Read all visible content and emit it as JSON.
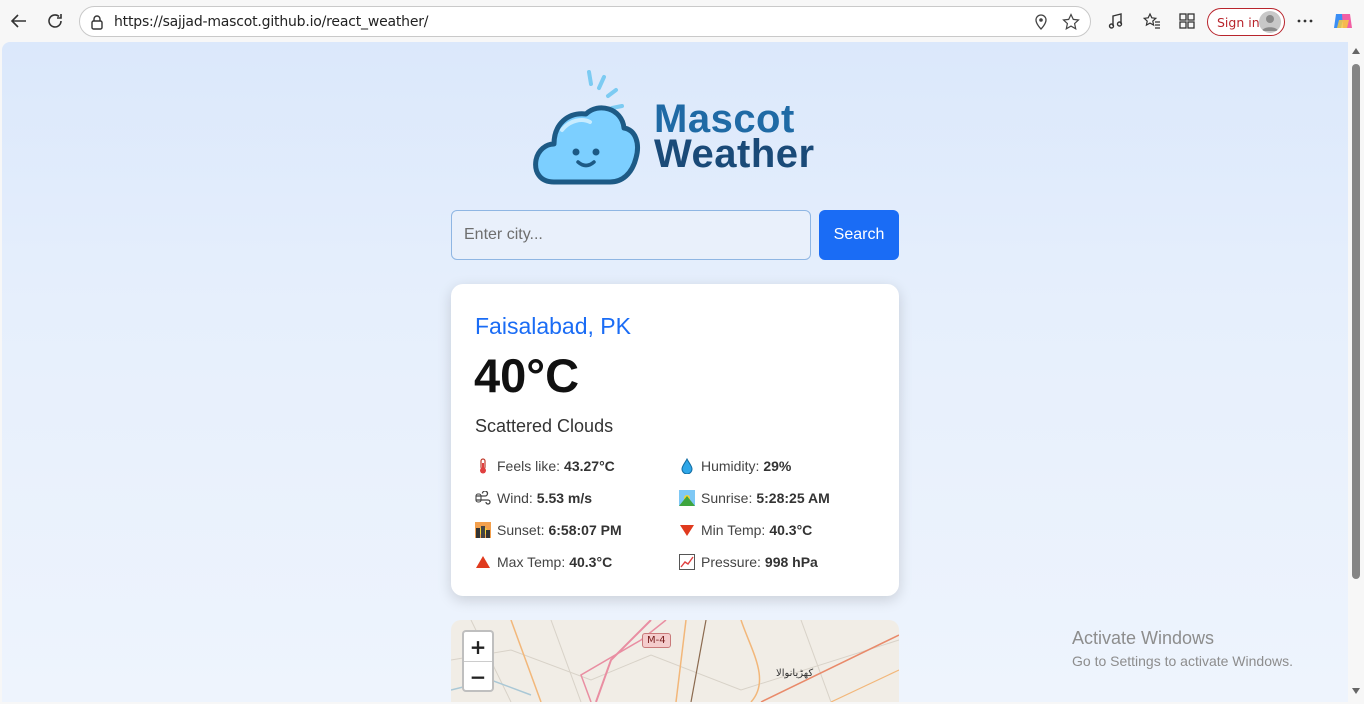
{
  "browser": {
    "url": "https://sajjad-mascot.github.io/react_weather/",
    "sign_in_label": "Sign in"
  },
  "logo": {
    "line1": "Mascot",
    "line2": "Weather"
  },
  "search": {
    "placeholder": "Enter city...",
    "button_label": "Search"
  },
  "weather": {
    "city": "Faisalabad, PK",
    "temperature": "40°C",
    "description": "Scattered Clouds",
    "stats": [
      {
        "label": "Feels like:",
        "value": "43.27°C",
        "icon": "thermometer-icon"
      },
      {
        "label": "Humidity:",
        "value": "29%",
        "icon": "droplet-icon"
      },
      {
        "label": "Wind:",
        "value": "5.53 m/s",
        "icon": "wind-icon"
      },
      {
        "label": "Sunrise:",
        "value": "5:28:25 AM",
        "icon": "sunrise-icon"
      },
      {
        "label": "Sunset:",
        "value": "6:58:07 PM",
        "icon": "sunset-icon"
      },
      {
        "label": "Min Temp:",
        "value": "40.3°C",
        "icon": "down-triangle-icon"
      },
      {
        "label": "Max Temp:",
        "value": "40.3°C",
        "icon": "up-triangle-icon"
      },
      {
        "label": "Pressure:",
        "value": "998 hPa",
        "icon": "chart-icon"
      }
    ]
  },
  "map": {
    "zoom_in": "+",
    "zoom_out": "−",
    "road_label": "M-4",
    "town_label": "کھڑیانوالا"
  },
  "watermark": {
    "title": "Activate Windows",
    "subtitle": "Go to Settings to activate Windows."
  },
  "colors": {
    "accent": "#1a6cf5",
    "city": "#1a6cf5",
    "sign_in": "#b8242c"
  }
}
